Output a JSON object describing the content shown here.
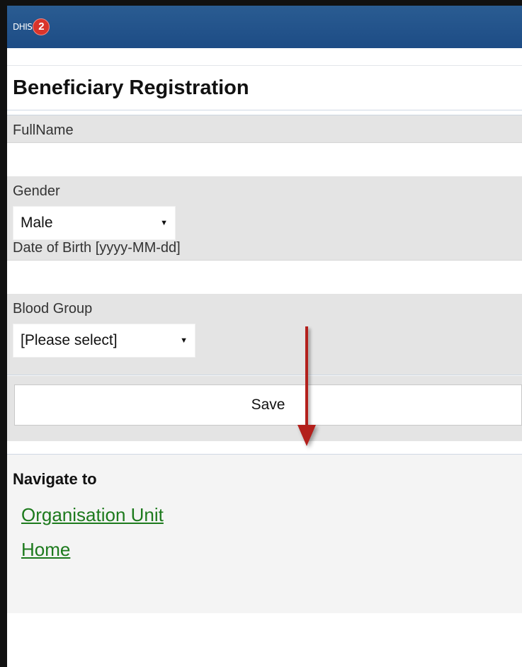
{
  "header": {
    "logo_text": "DHIS",
    "logo_badge": "2"
  },
  "page": {
    "title": "Beneficiary Registration"
  },
  "form": {
    "fullname": {
      "label": "FullName",
      "value": ""
    },
    "gender": {
      "label": "Gender",
      "selected": "Male"
    },
    "dob": {
      "label": "Date of Birth [yyyy-MM-dd]",
      "value": ""
    },
    "blood_group": {
      "label": "Blood Group",
      "selected": "[Please select]"
    },
    "save_label": "Save"
  },
  "nav": {
    "title": "Navigate to",
    "links": [
      "Organisation Unit",
      "Home"
    ]
  },
  "colors": {
    "header_blue": "#1d4c85",
    "arrow_red": "#b3201c",
    "link_green": "#1d7a1d"
  }
}
